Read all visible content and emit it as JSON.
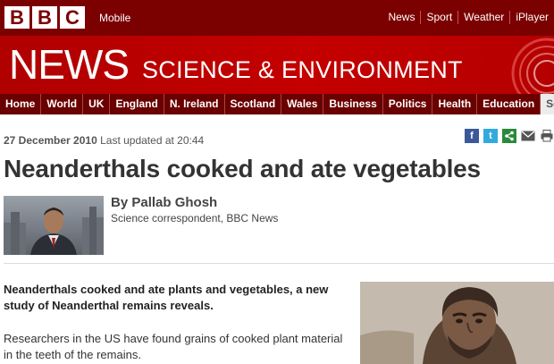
{
  "topbar": {
    "logo_letters": [
      "B",
      "B",
      "C"
    ],
    "mobile_label": "Mobile",
    "links": [
      "News",
      "Sport",
      "Weather",
      "iPlayer"
    ]
  },
  "masthead": {
    "news_label": "NEWS",
    "section_title": "SCIENCE & ENVIRONMENT"
  },
  "nav": {
    "items": [
      "Home",
      "World",
      "UK",
      "England",
      "N. Ireland",
      "Scotland",
      "Wales",
      "Business",
      "Politics",
      "Health",
      "Education",
      "Sci/E"
    ]
  },
  "article": {
    "date": "27 December 2010",
    "updated": "Last updated at 20:44",
    "headline": "Neanderthals cooked and ate vegetables",
    "author_name": "By Pallab Ghosh",
    "author_role": "Science correspondent, BBC News",
    "intro": "Neanderthals cooked and ate plants and vegetables, a new study of Neanderthal remains reveals.",
    "paragraph": "Researchers in the US have found grains of cooked plant material in the teeth of the remains."
  },
  "share": {
    "icons": [
      "facebook-icon",
      "twitter-icon",
      "share-icon",
      "email-icon",
      "print-icon"
    ]
  },
  "colors": {
    "topbar": "#7b0000",
    "masthead": "#c40000",
    "nav": "#6a0000"
  }
}
